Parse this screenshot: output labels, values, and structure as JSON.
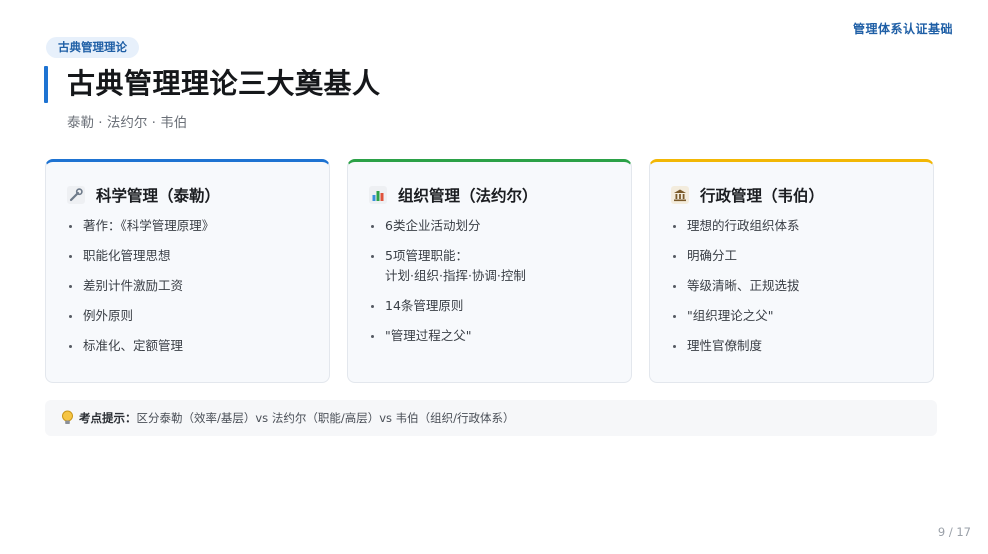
{
  "header": {
    "brand": "管理体系认证基础",
    "tag": "古典管理理论",
    "title": "古典管理理论三大奠基人",
    "subtitle": "泰勒 · 法约尔 · 韦伯"
  },
  "cards": [
    {
      "title": "科学管理（泰勒）",
      "icon": "wrench-icon",
      "accent": "#1e73d2",
      "items": [
        "著作：《科学管理原理》",
        "职能化管理思想",
        "差别计件激励工资",
        "例外原则",
        "标准化、定额管理"
      ]
    },
    {
      "title": "组织管理（法约尔）",
      "icon": "bar-chart-icon",
      "accent": "#2ba147",
      "items": [
        "6类企业活动划分",
        "5项管理职能：",
        "计划·组织·指挥·协调·控制",
        "14条管理原则",
        "\"管理过程之父\""
      ]
    },
    {
      "title": "行政管理（韦伯）",
      "icon": "bank-icon",
      "accent": "#f2b705",
      "items": [
        "理想的行政组织体系",
        "明确分工",
        "等级清晰、正规选拔",
        "\"组织理论之父\"",
        "理性官僚制度"
      ]
    }
  ],
  "hint": {
    "icon": "lightbulb-icon",
    "label": "考点提示：",
    "text": "区分泰勒（效率/基层）vs 法约尔（职能/高层）vs 韦伯（组织/行政体系）"
  },
  "footer": {
    "page": "9 / 17"
  }
}
